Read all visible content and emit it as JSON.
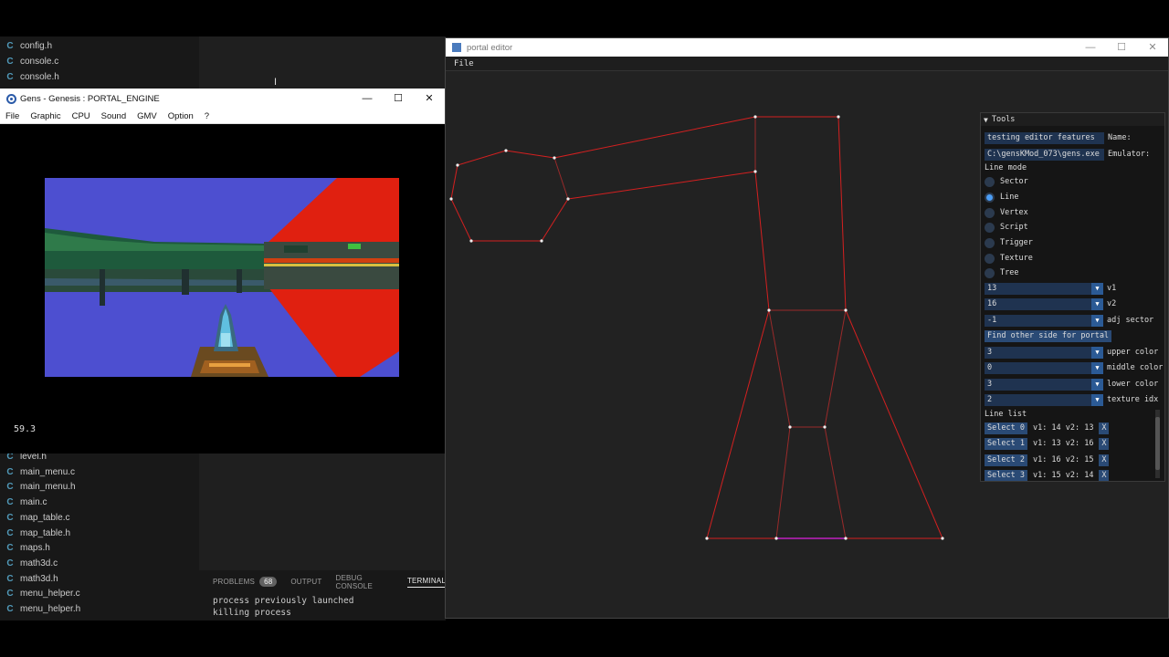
{
  "vscode": {
    "files_top": [
      "config.h",
      "console.c",
      "console.h"
    ],
    "files_bottom": [
      "level.h",
      "main_menu.c",
      "main_menu.h",
      "main.c",
      "map_table.c",
      "map_table.h",
      "maps.h",
      "math3d.c",
      "math3d.h",
      "menu_helper.c",
      "menu_helper.h"
    ],
    "file_icon": "C",
    "panel": {
      "tabs": [
        "PROBLEMS",
        "OUTPUT",
        "DEBUG CONSOLE",
        "TERMINAL"
      ],
      "problems_count": "68",
      "terminal_lines": [
        "process previously launched",
        "killing process"
      ]
    }
  },
  "gens": {
    "title": "Gens - Genesis : PORTAL_ENGINE",
    "menu": [
      "File",
      "Graphic",
      "CPU",
      "Sound",
      "GMV",
      "Option",
      "?"
    ],
    "fps": "59.3"
  },
  "portal_editor": {
    "title": "portal editor",
    "menu": [
      "File"
    ],
    "tools": {
      "header": "Tools",
      "project_name_value": "testing editor features",
      "project_name_label": "Name:",
      "emulator_value": "C:\\gensKMod_073\\gens.exe",
      "emulator_label": "Emulator:",
      "line_mode_label": "Line mode",
      "modes": [
        "Sector",
        "Line",
        "Vertex",
        "Script",
        "Trigger",
        "Texture",
        "Tree"
      ],
      "selected_mode": "Line",
      "combos": [
        {
          "value": "13",
          "label": "v1"
        },
        {
          "value": "16",
          "label": "v2"
        },
        {
          "value": "-1",
          "label": "adj sector"
        }
      ],
      "find_portal_button": "Find other side for portal",
      "color_combos": [
        {
          "value": "3",
          "label": "upper color"
        },
        {
          "value": "0",
          "label": "middle color"
        },
        {
          "value": "3",
          "label": "lower color"
        },
        {
          "value": "2",
          "label": "texture idx"
        }
      ],
      "line_list_label": "Line list",
      "line_list": [
        {
          "button": "Select 0",
          "info": "v1: 14 v2: 13"
        },
        {
          "button": "Select 1",
          "info": "v1: 13 v2: 16"
        },
        {
          "button": "Select 2",
          "info": "v1: 16 v2: 15"
        },
        {
          "button": "Select 3",
          "info": "v1: 15 v2: 14"
        }
      ],
      "delete_glyph": "X"
    }
  },
  "colors": {
    "map_line": "#d42020",
    "portal_line": "#9a2a2a",
    "highlight_line": "#c020c0",
    "button": "#2a4a75",
    "radio_on": "#4b9df5"
  }
}
